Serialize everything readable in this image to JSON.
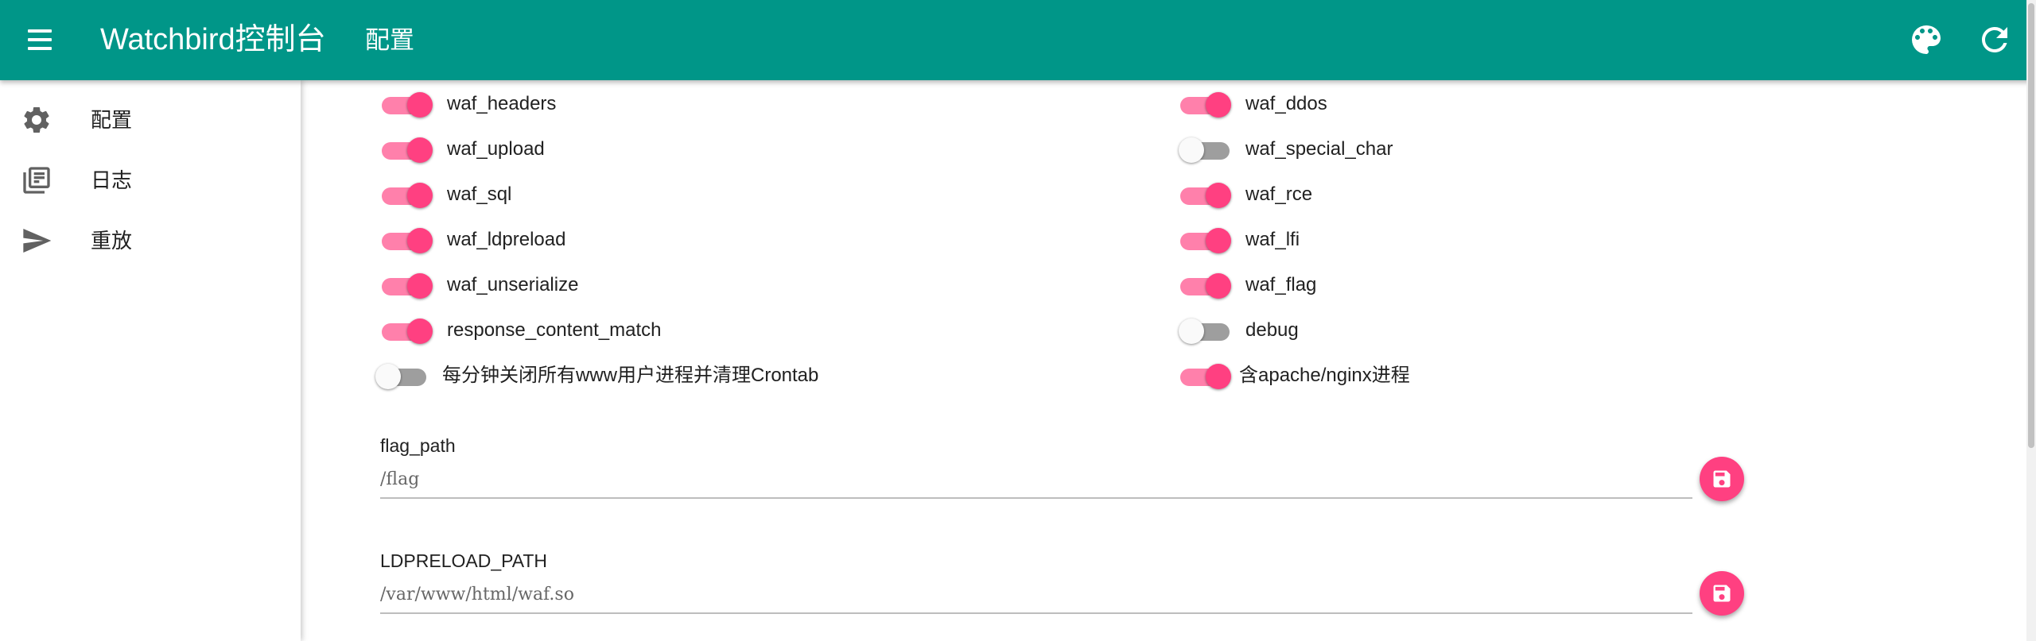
{
  "appbar": {
    "title": "Watchbird控制台",
    "subtitle": "配置"
  },
  "sidebar": {
    "items": [
      {
        "label": "配置",
        "icon": "gear-icon"
      },
      {
        "label": "日志",
        "icon": "library-books-icon"
      },
      {
        "label": "重放",
        "icon": "send-icon"
      }
    ]
  },
  "toggles": {
    "left": [
      {
        "label": "waf_headers",
        "on": true
      },
      {
        "label": "waf_upload",
        "on": true
      },
      {
        "label": "waf_sql",
        "on": true
      },
      {
        "label": "waf_ldpreload",
        "on": true
      },
      {
        "label": "waf_unserialize",
        "on": true
      },
      {
        "label": "response_content_match",
        "on": true
      },
      {
        "label": "每分钟关闭所有www用户进程并清理Crontab",
        "on": false
      }
    ],
    "right": [
      {
        "label": "waf_ddos",
        "on": true
      },
      {
        "label": "waf_special_char",
        "on": false
      },
      {
        "label": "waf_rce",
        "on": true
      },
      {
        "label": "waf_lfi",
        "on": true
      },
      {
        "label": "waf_flag",
        "on": true
      },
      {
        "label": "debug",
        "on": false
      },
      {
        "label": "含apache/nginx进程",
        "on": true
      }
    ]
  },
  "fields": [
    {
      "label": "flag_path",
      "value": "/flag"
    },
    {
      "label": "LDPRELOAD_PATH",
      "value": "/var/www/html/waf.so"
    }
  ],
  "colors": {
    "primary": "#009688",
    "accent": "#ff4081",
    "accent_light": "#ff80ab",
    "switch_off": "#9e9e9e"
  }
}
